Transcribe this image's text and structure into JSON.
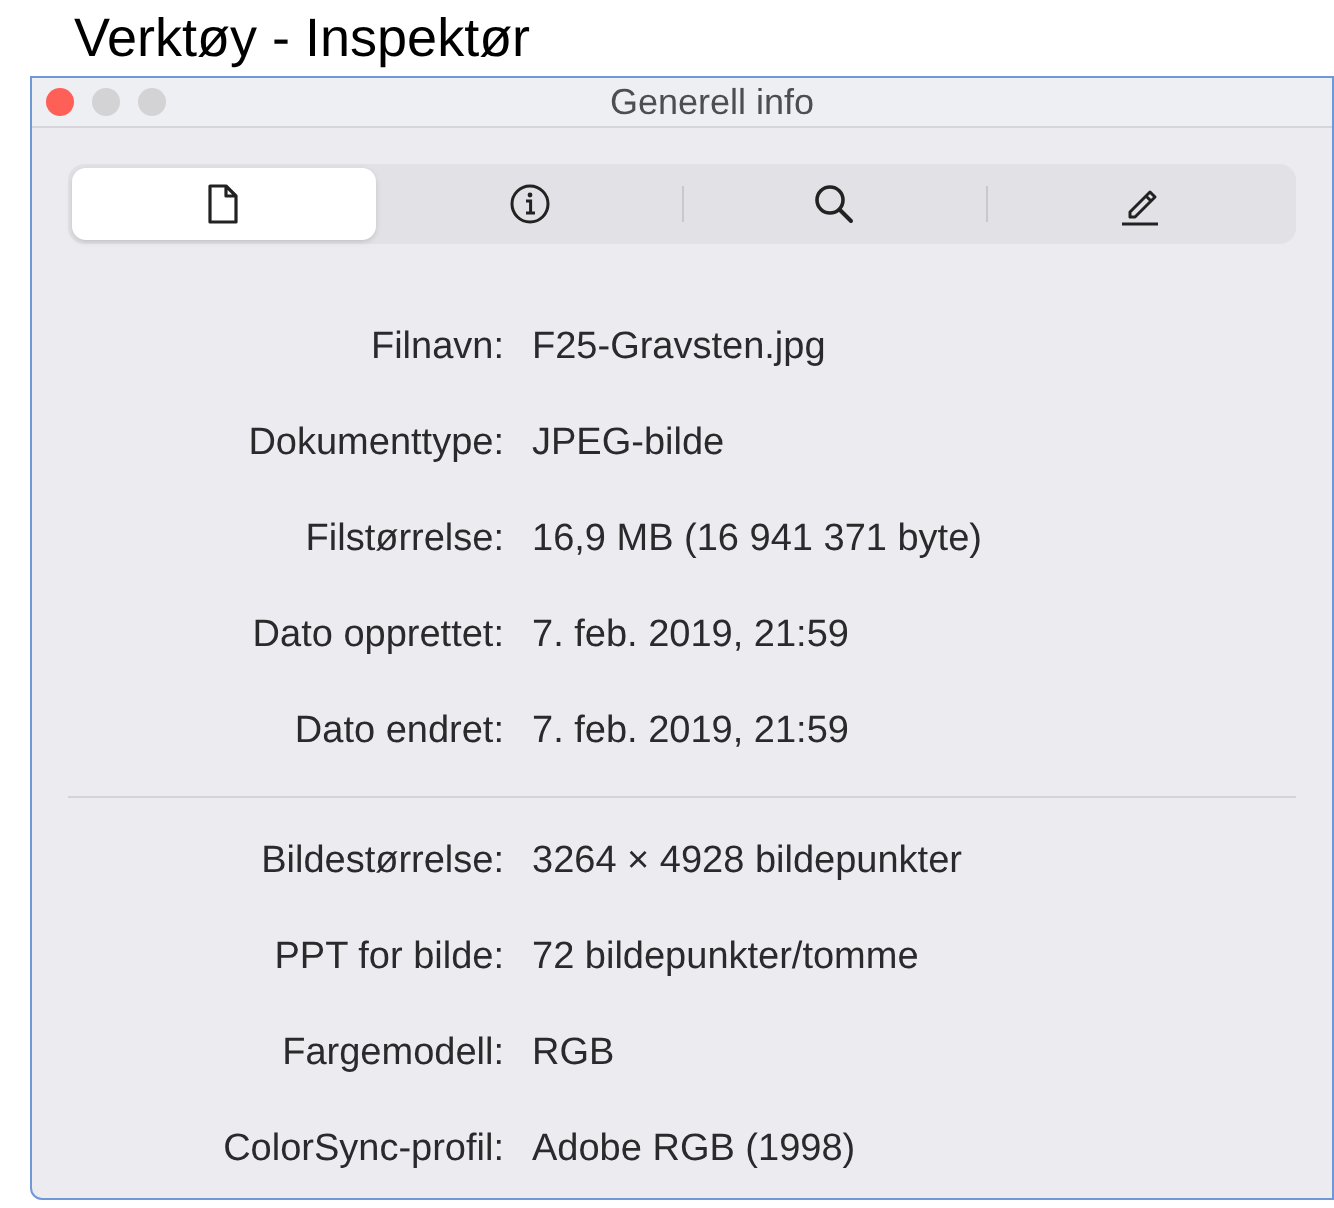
{
  "heading": "Verktøy - Inspektør",
  "window": {
    "title": "Generell info"
  },
  "tabs": [
    {
      "kind": "document",
      "selected": true
    },
    {
      "kind": "info",
      "selected": false
    },
    {
      "kind": "search",
      "selected": false
    },
    {
      "kind": "pencil",
      "selected": false
    }
  ],
  "sections": [
    {
      "rows": [
        {
          "label": "Filnavn:",
          "value": "F25-Gravsten.jpg"
        },
        {
          "label": "Dokumenttype:",
          "value": "JPEG-bilde"
        },
        {
          "label": "Filstørrelse:",
          "value": "16,9 MB (16 941 371 byte)"
        },
        {
          "label": "Dato opprettet:",
          "value": "7. feb. 2019, 21:59"
        },
        {
          "label": "Dato endret:",
          "value": "7. feb. 2019, 21:59"
        }
      ]
    },
    {
      "rows": [
        {
          "label": "Bildestørrelse:",
          "value": "3264 × 4928 bildepunkter"
        },
        {
          "label": "PPT for bilde:",
          "value": "72 bildepunkter/tomme"
        },
        {
          "label": "Fargemodell:",
          "value": "RGB"
        },
        {
          "label": "ColorSync-profil:",
          "value": "Adobe RGB (1998)"
        }
      ]
    }
  ]
}
